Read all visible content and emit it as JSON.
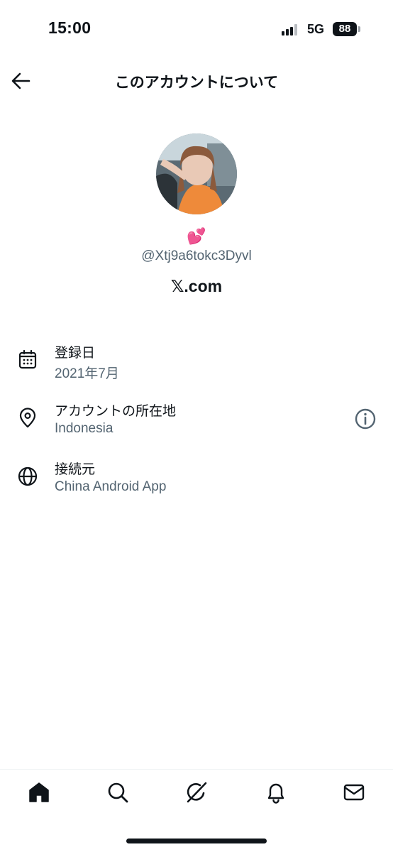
{
  "status_bar": {
    "time": "15:00",
    "network": "5G",
    "battery": "88"
  },
  "header": {
    "title": "このアカウントについて",
    "back_icon": "arrow-left-icon"
  },
  "profile": {
    "display_name": "💕",
    "handle": "@Xtj9a6tokc3Dyvl",
    "domain": "𝕏.com"
  },
  "info_rows": [
    {
      "icon": "calendar-icon",
      "title": "登録日",
      "value": "2021年7月"
    },
    {
      "icon": "location-pin-icon",
      "title": "アカウントの所在地",
      "value": "Indonesia"
    },
    {
      "icon": "globe-icon",
      "title": "接続元",
      "value": "China Android App"
    }
  ],
  "bottom_nav": {
    "items": [
      "home-icon",
      "search-icon",
      "grok-icon",
      "notifications-icon",
      "messages-icon"
    ]
  },
  "colors": {
    "text_primary": "#0f1419",
    "text_secondary": "#536471",
    "background": "#ffffff"
  }
}
